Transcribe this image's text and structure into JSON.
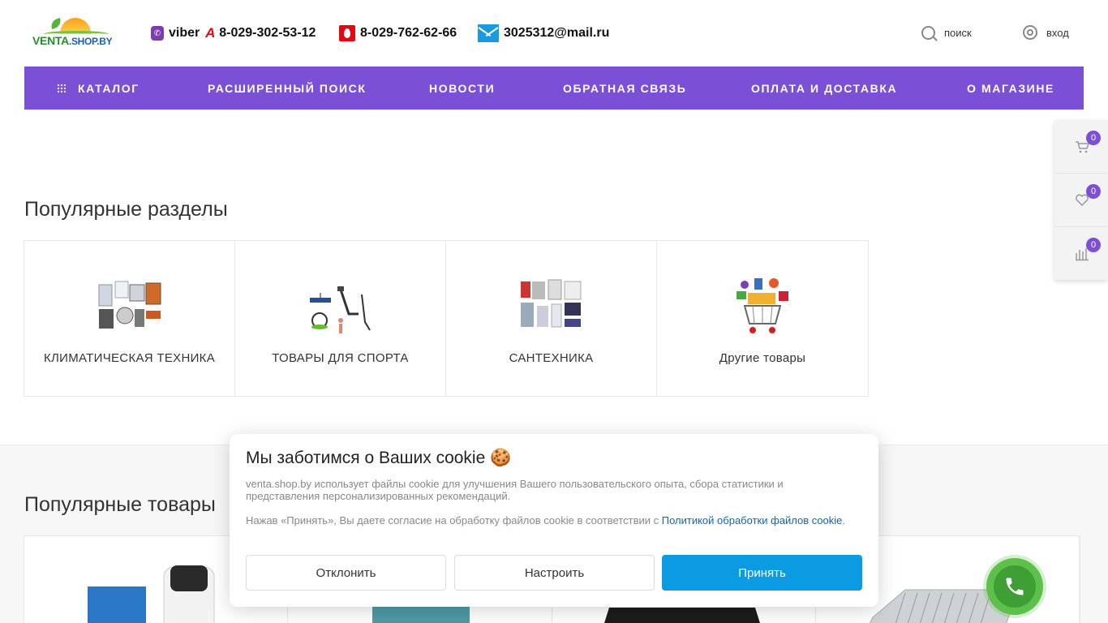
{
  "header": {
    "logo": {
      "brand": "VENTA",
      "domain": ".SHOP.BY"
    },
    "viber_label": "viber",
    "phone_a1": "8-029-302-53-12",
    "phone_mts": "8-029-762-62-66",
    "email": "3025312@mail.ru",
    "search_label": "поиск",
    "login_label": "вход"
  },
  "nav": {
    "items": [
      "Каталог",
      "Расширенный поиск",
      "Новости",
      "Обратная связь",
      "Оплата и доставка",
      "О магазине"
    ]
  },
  "side_panel": {
    "cart_count": "0",
    "favorites_count": "0",
    "compare_count": "0"
  },
  "popular_sections": {
    "title": "Популярные разделы",
    "items": [
      {
        "label": "КЛИМАТИЧЕСКАЯ ТЕХНИКА"
      },
      {
        "label": "ТОВАРЫ ДЛЯ СПОРТА"
      },
      {
        "label": "САНТЕХНИКА"
      },
      {
        "label": "Другие товары"
      }
    ]
  },
  "popular_products": {
    "title": "Популярные товары"
  },
  "cookie": {
    "title": "Мы заботимся о Ваших cookie 🍪",
    "text1": "venta.shop.by использует файлы cookie для улучшения Вашего пользовательского опыта, сбора статистики и представления персонализированных рекомендаций.",
    "text2_prefix": "Нажав «Принять», Вы даете согласие на обработку файлов cookie в соответствии с ",
    "text2_link": "Политикой обработки файлов cookie",
    "text2_suffix": ".",
    "decline": "Отклонить",
    "customize": "Настроить",
    "accept": "Принять"
  },
  "colors": {
    "accent_purple": "#7b4fd6",
    "accept_blue": "#0b9be3",
    "call_green": "#5cc04a"
  }
}
